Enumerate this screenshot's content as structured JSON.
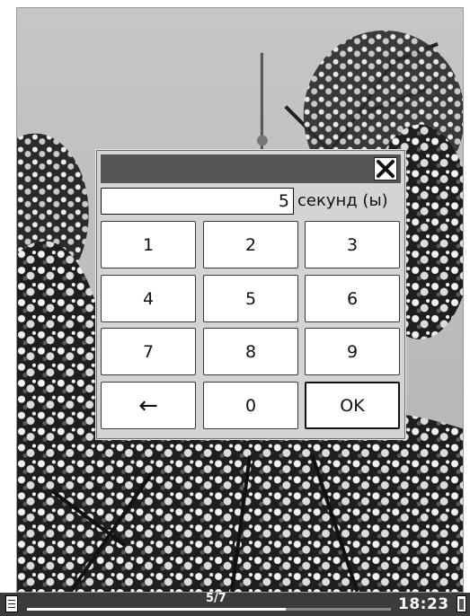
{
  "dialog": {
    "close_icon": "close-x-icon",
    "value": "5",
    "unit": "секунд (ы)",
    "keys": {
      "k1": "1",
      "k2": "2",
      "k3": "3",
      "k4": "4",
      "k5": "5",
      "k6": "6",
      "k7": "7",
      "k8": "8",
      "k9": "9",
      "backspace": "←",
      "k0": "0",
      "ok": "OK"
    }
  },
  "statusbar": {
    "page": "5/7",
    "progress": 0.71,
    "time": "18:23",
    "left_icon": "menu-icon",
    "right_icon": "battery-icon"
  }
}
